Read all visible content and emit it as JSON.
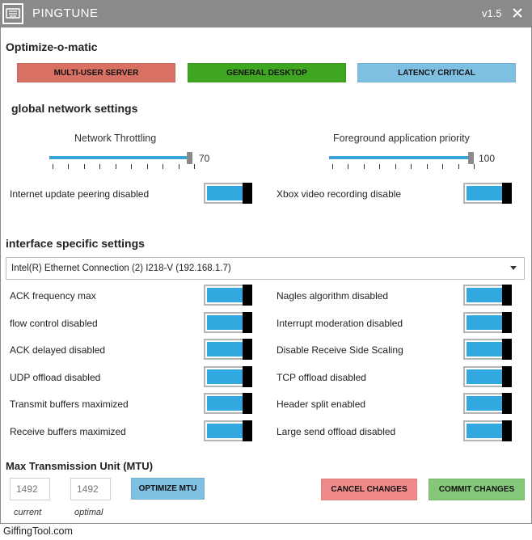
{
  "app": {
    "title": "PINGTUNE",
    "version": "v1.5"
  },
  "optimize": {
    "title": "Optimize-o-matic",
    "presets": [
      {
        "label": "MULTI-USER SERVER",
        "color": "#d87063"
      },
      {
        "label": "GENERAL DESKTOP",
        "color": "#3fa621"
      },
      {
        "label": "LATENCY CRITICAL",
        "color": "#7ebfe2"
      }
    ]
  },
  "global": {
    "title": "global network settings",
    "sliders": [
      {
        "label": "Network Throttling",
        "value": "70",
        "level": 0.99
      },
      {
        "label": "Foreground application priority",
        "value": "100",
        "level": 1.0
      }
    ],
    "toggles": [
      {
        "label": "Internet update peering disabled",
        "on": true
      },
      {
        "label": "Xbox video recording disable",
        "on": true
      }
    ]
  },
  "interface": {
    "title": "interface specific settings",
    "adapter": "Intel(R) Ethernet Connection (2) I218-V (192.168.1.7)",
    "toggles": [
      {
        "label": "ACK frequency max",
        "on": true
      },
      {
        "label": "Nagles algorithm disabled",
        "on": true
      },
      {
        "label": "flow control disabled",
        "on": true
      },
      {
        "label": "Interrupt moderation disabled",
        "on": true
      },
      {
        "label": "ACK delayed disabled",
        "on": true
      },
      {
        "label": "Disable Receive Side Scaling",
        "on": true
      },
      {
        "label": "UDP offload disabled",
        "on": true
      },
      {
        "label": "TCP offload disabled",
        "on": true
      },
      {
        "label": "Transmit buffers maximized",
        "on": true
      },
      {
        "label": "Header split enabled",
        "on": true
      },
      {
        "label": "Receive buffers maximized",
        "on": true
      },
      {
        "label": "Large send offload disabled",
        "on": true
      }
    ]
  },
  "mtu": {
    "title": "Max Transmission Unit (MTU)",
    "current": "1492",
    "current_label": "current",
    "optimal": "1492",
    "optimal_label": "optimal",
    "optimize_label": "OPTIMIZE MTU"
  },
  "actions": {
    "cancel_label": "CANCEL CHANGES",
    "commit_label": "COMMIT CHANGES"
  },
  "watermark": "GiffingTool.com",
  "colors": {
    "titlebar": "#8a8a8a",
    "toggle_on": "#32a8e0",
    "optimize_btn": "#7ebfe2",
    "cancel_btn": "#f08a8a",
    "commit_btn": "#85c779"
  }
}
